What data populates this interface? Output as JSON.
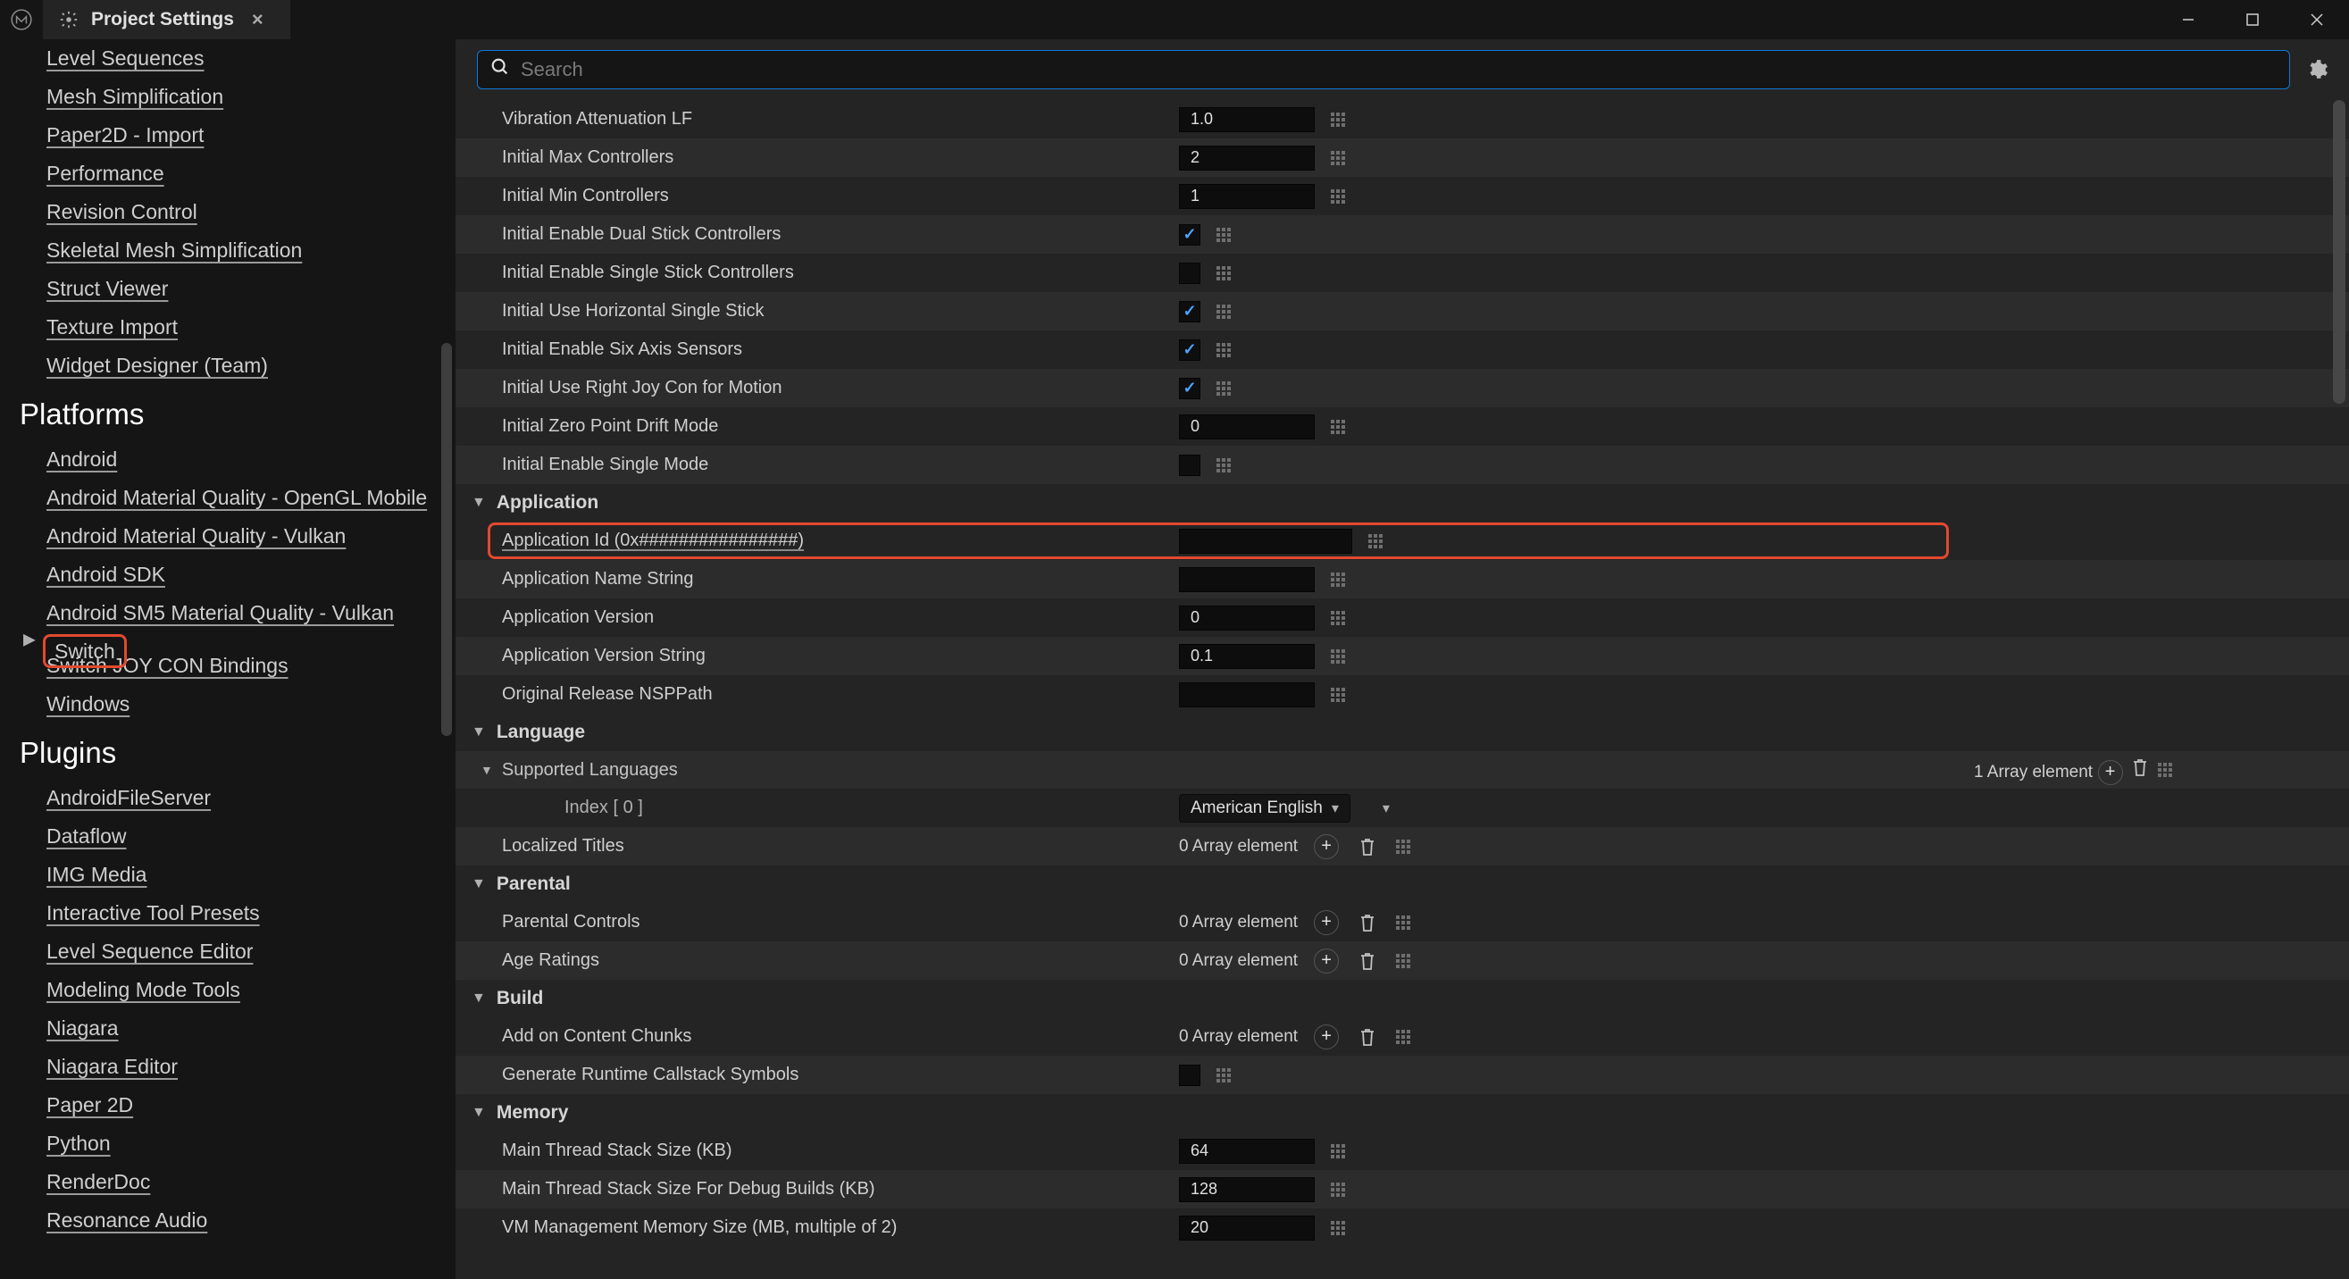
{
  "window": {
    "title": "Project Settings"
  },
  "search": {
    "placeholder": "Search"
  },
  "sidebar": {
    "top_items": [
      "Level Sequences",
      "Mesh Simplification",
      "Paper2D - Import",
      "Performance",
      "Revision Control",
      "Skeletal Mesh Simplification",
      "Struct Viewer",
      "Texture Import",
      "Widget Designer (Team)"
    ],
    "platforms_head": "Platforms",
    "platforms": [
      "Android",
      "Android Material Quality - OpenGL Mobile",
      "Android Material Quality - Vulkan",
      "Android SDK",
      "Android SM5 Material Quality - Vulkan",
      "Switch",
      "Switch JOY CON Bindings",
      "Windows"
    ],
    "plugins_head": "Plugins",
    "plugins": [
      "AndroidFileServer",
      "Dataflow",
      "IMG Media",
      "Interactive Tool Presets",
      "Level Sequence Editor",
      "Modeling Mode Tools",
      "Niagara",
      "Niagara Editor",
      "Paper 2D",
      "Python",
      "RenderDoc",
      "Resonance Audio"
    ],
    "selected_platform_index": 5
  },
  "settings": {
    "top": [
      {
        "label": "Vibration Attenuation LF",
        "type": "num",
        "value": "1.0"
      },
      {
        "label": "Initial Max Controllers",
        "type": "num",
        "value": "2"
      },
      {
        "label": "Initial Min Controllers",
        "type": "num",
        "value": "1"
      },
      {
        "label": "Initial Enable Dual Stick Controllers",
        "type": "chk",
        "checked": true
      },
      {
        "label": "Initial Enable Single Stick Controllers",
        "type": "chk",
        "checked": false
      },
      {
        "label": "Initial Use Horizontal Single Stick",
        "type": "chk",
        "checked": true
      },
      {
        "label": "Initial Enable Six Axis Sensors",
        "type": "chk",
        "checked": true
      },
      {
        "label": "Initial Use Right Joy Con for Motion",
        "type": "chk",
        "checked": true
      },
      {
        "label": "Initial Zero Point Drift Mode",
        "type": "num",
        "value": "0"
      },
      {
        "label": "Initial Enable Single Mode",
        "type": "chk",
        "checked": false
      }
    ],
    "application_head": "Application",
    "application": [
      {
        "label": "Application Id (0x################)",
        "type": "txt",
        "value": "",
        "link": true,
        "highlight": true
      },
      {
        "label": "Application Name String",
        "type": "txt",
        "value": ""
      },
      {
        "label": "Application Version",
        "type": "num",
        "value": "0"
      },
      {
        "label": "Application Version String",
        "type": "num",
        "value": "0.1"
      },
      {
        "label": "Original Release NSPPath",
        "type": "txt",
        "value": ""
      }
    ],
    "language_head": "Language",
    "supported_languages_label": "Supported Languages",
    "supported_languages_count": "1 Array element",
    "sup_lang_index_label": "Index [ 0 ]",
    "sup_lang_index_value": "American English",
    "localized_titles_label": "Localized Titles",
    "localized_titles_count": "0 Array element",
    "parental_head": "Parental",
    "parental": [
      {
        "label": "Parental Controls",
        "count": "0 Array element"
      },
      {
        "label": "Age Ratings",
        "count": "0 Array element"
      }
    ],
    "build_head": "Build",
    "build": [
      {
        "label": "Add on Content Chunks",
        "type": "arr",
        "count": "0 Array element"
      },
      {
        "label": "Generate Runtime Callstack Symbols",
        "type": "chk",
        "checked": false
      }
    ],
    "memory_head": "Memory",
    "memory": [
      {
        "label": "Main Thread Stack Size (KB)",
        "value": "64"
      },
      {
        "label": "Main Thread Stack Size For Debug Builds (KB)",
        "value": "128"
      },
      {
        "label": "VM Management Memory Size (MB, multiple of 2)",
        "value": "20"
      }
    ]
  }
}
